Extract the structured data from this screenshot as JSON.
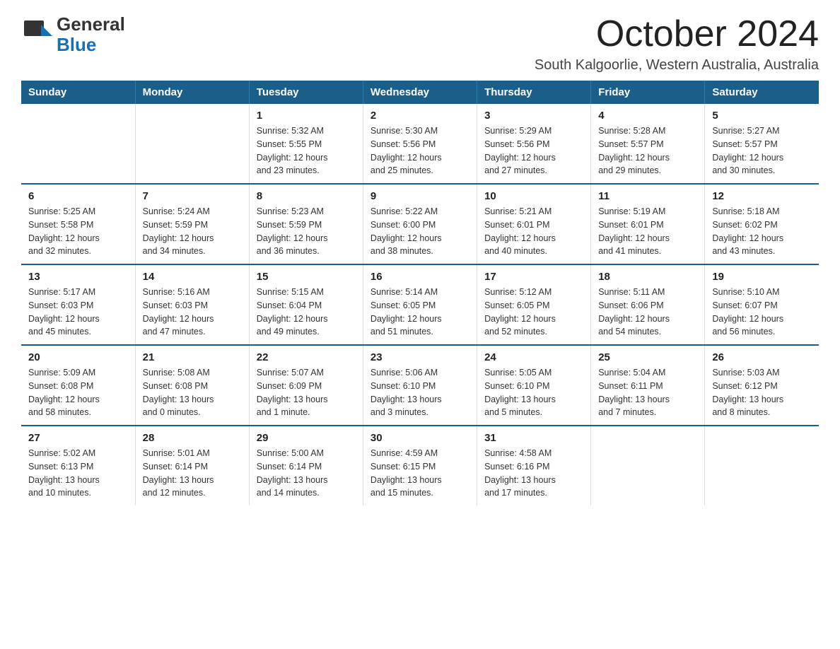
{
  "logo": {
    "general": "General",
    "blue": "Blue"
  },
  "title": "October 2024",
  "subtitle": "South Kalgoorlie, Western Australia, Australia",
  "weekdays": [
    "Sunday",
    "Monday",
    "Tuesday",
    "Wednesday",
    "Thursday",
    "Friday",
    "Saturday"
  ],
  "weeks": [
    [
      {
        "day": "",
        "info": ""
      },
      {
        "day": "",
        "info": ""
      },
      {
        "day": "1",
        "info": "Sunrise: 5:32 AM\nSunset: 5:55 PM\nDaylight: 12 hours\nand 23 minutes."
      },
      {
        "day": "2",
        "info": "Sunrise: 5:30 AM\nSunset: 5:56 PM\nDaylight: 12 hours\nand 25 minutes."
      },
      {
        "day": "3",
        "info": "Sunrise: 5:29 AM\nSunset: 5:56 PM\nDaylight: 12 hours\nand 27 minutes."
      },
      {
        "day": "4",
        "info": "Sunrise: 5:28 AM\nSunset: 5:57 PM\nDaylight: 12 hours\nand 29 minutes."
      },
      {
        "day": "5",
        "info": "Sunrise: 5:27 AM\nSunset: 5:57 PM\nDaylight: 12 hours\nand 30 minutes."
      }
    ],
    [
      {
        "day": "6",
        "info": "Sunrise: 5:25 AM\nSunset: 5:58 PM\nDaylight: 12 hours\nand 32 minutes."
      },
      {
        "day": "7",
        "info": "Sunrise: 5:24 AM\nSunset: 5:59 PM\nDaylight: 12 hours\nand 34 minutes."
      },
      {
        "day": "8",
        "info": "Sunrise: 5:23 AM\nSunset: 5:59 PM\nDaylight: 12 hours\nand 36 minutes."
      },
      {
        "day": "9",
        "info": "Sunrise: 5:22 AM\nSunset: 6:00 PM\nDaylight: 12 hours\nand 38 minutes."
      },
      {
        "day": "10",
        "info": "Sunrise: 5:21 AM\nSunset: 6:01 PM\nDaylight: 12 hours\nand 40 minutes."
      },
      {
        "day": "11",
        "info": "Sunrise: 5:19 AM\nSunset: 6:01 PM\nDaylight: 12 hours\nand 41 minutes."
      },
      {
        "day": "12",
        "info": "Sunrise: 5:18 AM\nSunset: 6:02 PM\nDaylight: 12 hours\nand 43 minutes."
      }
    ],
    [
      {
        "day": "13",
        "info": "Sunrise: 5:17 AM\nSunset: 6:03 PM\nDaylight: 12 hours\nand 45 minutes."
      },
      {
        "day": "14",
        "info": "Sunrise: 5:16 AM\nSunset: 6:03 PM\nDaylight: 12 hours\nand 47 minutes."
      },
      {
        "day": "15",
        "info": "Sunrise: 5:15 AM\nSunset: 6:04 PM\nDaylight: 12 hours\nand 49 minutes."
      },
      {
        "day": "16",
        "info": "Sunrise: 5:14 AM\nSunset: 6:05 PM\nDaylight: 12 hours\nand 51 minutes."
      },
      {
        "day": "17",
        "info": "Sunrise: 5:12 AM\nSunset: 6:05 PM\nDaylight: 12 hours\nand 52 minutes."
      },
      {
        "day": "18",
        "info": "Sunrise: 5:11 AM\nSunset: 6:06 PM\nDaylight: 12 hours\nand 54 minutes."
      },
      {
        "day": "19",
        "info": "Sunrise: 5:10 AM\nSunset: 6:07 PM\nDaylight: 12 hours\nand 56 minutes."
      }
    ],
    [
      {
        "day": "20",
        "info": "Sunrise: 5:09 AM\nSunset: 6:08 PM\nDaylight: 12 hours\nand 58 minutes."
      },
      {
        "day": "21",
        "info": "Sunrise: 5:08 AM\nSunset: 6:08 PM\nDaylight: 13 hours\nand 0 minutes."
      },
      {
        "day": "22",
        "info": "Sunrise: 5:07 AM\nSunset: 6:09 PM\nDaylight: 13 hours\nand 1 minute."
      },
      {
        "day": "23",
        "info": "Sunrise: 5:06 AM\nSunset: 6:10 PM\nDaylight: 13 hours\nand 3 minutes."
      },
      {
        "day": "24",
        "info": "Sunrise: 5:05 AM\nSunset: 6:10 PM\nDaylight: 13 hours\nand 5 minutes."
      },
      {
        "day": "25",
        "info": "Sunrise: 5:04 AM\nSunset: 6:11 PM\nDaylight: 13 hours\nand 7 minutes."
      },
      {
        "day": "26",
        "info": "Sunrise: 5:03 AM\nSunset: 6:12 PM\nDaylight: 13 hours\nand 8 minutes."
      }
    ],
    [
      {
        "day": "27",
        "info": "Sunrise: 5:02 AM\nSunset: 6:13 PM\nDaylight: 13 hours\nand 10 minutes."
      },
      {
        "day": "28",
        "info": "Sunrise: 5:01 AM\nSunset: 6:14 PM\nDaylight: 13 hours\nand 12 minutes."
      },
      {
        "day": "29",
        "info": "Sunrise: 5:00 AM\nSunset: 6:14 PM\nDaylight: 13 hours\nand 14 minutes."
      },
      {
        "day": "30",
        "info": "Sunrise: 4:59 AM\nSunset: 6:15 PM\nDaylight: 13 hours\nand 15 minutes."
      },
      {
        "day": "31",
        "info": "Sunrise: 4:58 AM\nSunset: 6:16 PM\nDaylight: 13 hours\nand 17 minutes."
      },
      {
        "day": "",
        "info": ""
      },
      {
        "day": "",
        "info": ""
      }
    ]
  ]
}
